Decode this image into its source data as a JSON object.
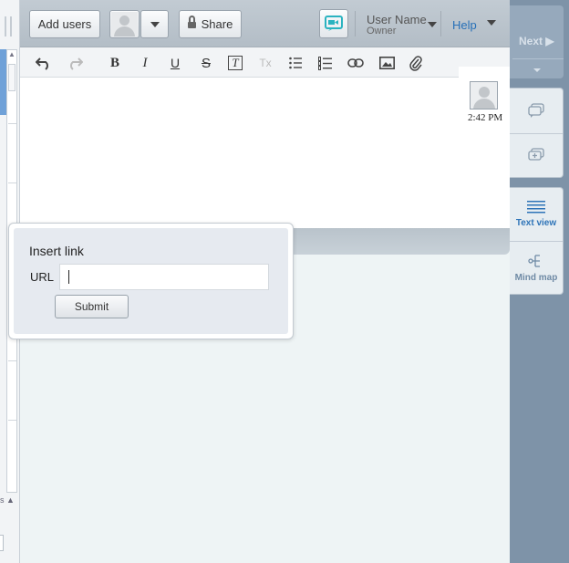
{
  "topbar": {
    "add_users_label": "Add users",
    "share_label": "Share",
    "user": {
      "name": "User Name",
      "role": "Owner"
    },
    "help_label": "Help",
    "video_icon_color": "#2bb3c0"
  },
  "editor": {
    "toolbar": {
      "bold": "B",
      "italic": "I",
      "underline": "U",
      "strikethrough": "S",
      "text_style": "T",
      "clear_format": "Tx"
    },
    "message": {
      "time": "2:42 PM"
    }
  },
  "right_panel": {
    "next_label": "Next ▶",
    "text_view_label": "Text view",
    "mind_map_label": "Mind map"
  },
  "insert_link_dialog": {
    "title": "Insert link",
    "url_label": "URL",
    "url_value": "",
    "submit_label": "Submit"
  },
  "left_gutter": {
    "collapsed_text": "s"
  },
  "colors": {
    "accent": "#2e74b8",
    "rightbar": "#7e93a8",
    "panel_bg": "#eef4f5"
  }
}
